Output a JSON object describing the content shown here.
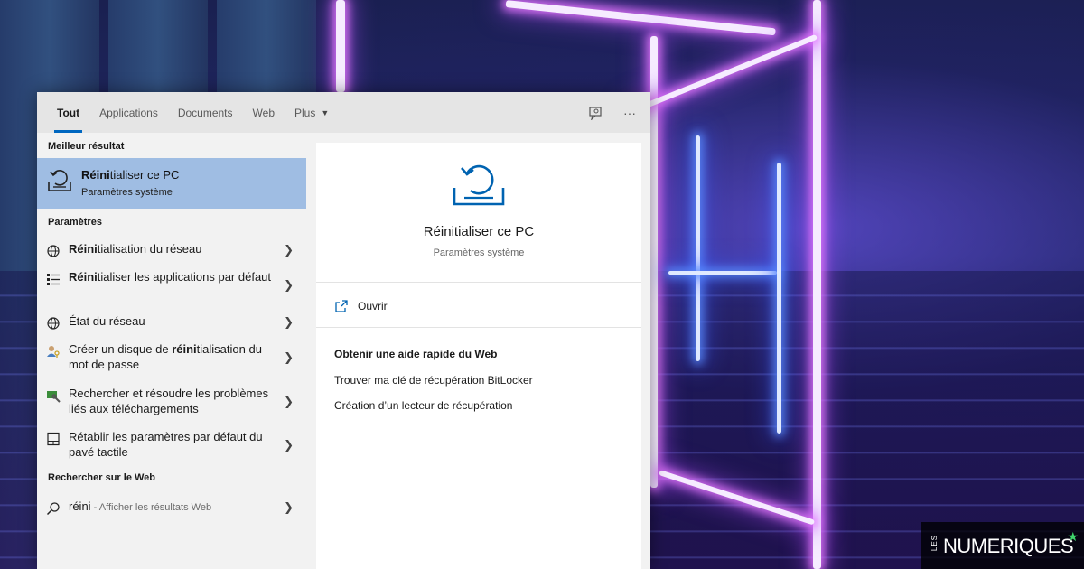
{
  "tabs": [
    {
      "label": "Tout",
      "active": true
    },
    {
      "label": "Applications"
    },
    {
      "label": "Documents"
    },
    {
      "label": "Web"
    },
    {
      "label": "Plus"
    }
  ],
  "tab_actions": {
    "feedback_icon": "feedback-icon",
    "more_icon": "more-icon",
    "more_glyph": "···"
  },
  "left": {
    "best_section": "Meilleur résultat",
    "best": {
      "title_bold": "Réini",
      "title_rest": "tialiser ce PC",
      "subtitle": "Paramètres système",
      "icon": "reset-pc-icon"
    },
    "settings_section": "Paramètres",
    "settings_items": [
      {
        "pre": "",
        "bold": "Réini",
        "post": "tialisation du réseau",
        "icon": "globe-icon"
      },
      {
        "pre": "",
        "bold": "Réini",
        "post": "tialiser les applications par défaut",
        "icon": "app-list-icon"
      },
      {
        "pre": "État du réseau",
        "bold": "",
        "post": "",
        "icon": "globe-icon"
      },
      {
        "pre": "Créer un disque de ",
        "bold": "réini",
        "post": "tialisation du mot de passe",
        "icon": "user-key-icon"
      },
      {
        "pre": "Rechercher et résoudre les problèmes liés aux téléchargements",
        "bold": "",
        "post": "",
        "icon": "wrench-icon"
      },
      {
        "pre": "Rétablir les paramètres par défaut du pavé tactile",
        "bold": "",
        "post": "",
        "icon": "touchpad-icon"
      }
    ],
    "web_section": "Rechercher sur le Web",
    "web_item": {
      "query": "réini",
      "hint": " - Afficher les résultats Web",
      "icon": "search-icon"
    }
  },
  "right": {
    "title": "Réinitialiser ce PC",
    "subtitle": "Paramètres système",
    "open_label": "Ouvrir",
    "web_help_title": "Obtenir une aide rapide du Web",
    "web_links": [
      "Trouver ma clé de récupération BitLocker",
      "Création d’un lecteur de récupération"
    ]
  },
  "logo": {
    "les": "LES",
    "brand": "NUMERIQUES",
    "star": "★"
  },
  "colors": {
    "accent": "#0067c0",
    "selection": "#9fbde3",
    "icon_blue": "#0063b1"
  }
}
